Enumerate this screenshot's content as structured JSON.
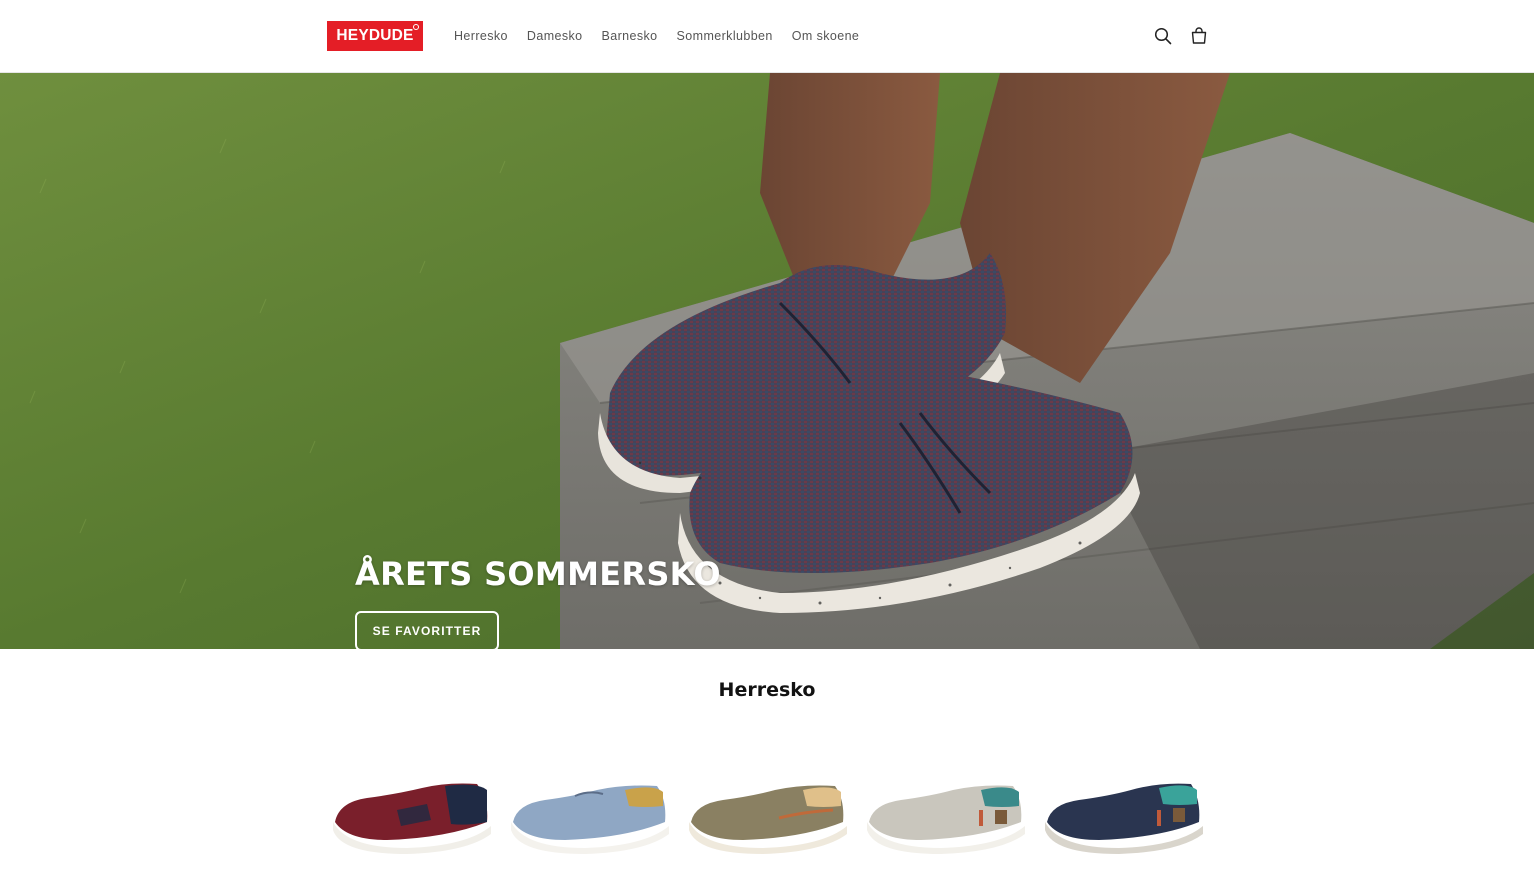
{
  "header": {
    "logo_text": "HEYDUDE",
    "nav": [
      "Herresko",
      "Damesko",
      "Barnesko",
      "Sommerklubben",
      "Om skoene"
    ],
    "icons": {
      "search": "search-icon",
      "cart": "cart-icon"
    }
  },
  "hero": {
    "title": "ÅRETS SOMMERSKO",
    "button_label": "SE FAVORITTER"
  },
  "section": {
    "title": "Herresko",
    "products": [
      {
        "color_name": "burgundy",
        "upper": "#7a1f2b",
        "accent": "#1f2a44"
      },
      {
        "color_name": "light-blue",
        "upper": "#8fa7c4",
        "accent": "#c9a24a"
      },
      {
        "color_name": "olive",
        "upper": "#8a8062",
        "accent": "#c06a3a"
      },
      {
        "color_name": "light-grey",
        "upper": "#c9c6bd",
        "accent": "#3a8a8a"
      },
      {
        "color_name": "navy",
        "upper": "#2a3550",
        "accent": "#3aa39a"
      }
    ]
  },
  "colors": {
    "brand": "#e41e26"
  }
}
